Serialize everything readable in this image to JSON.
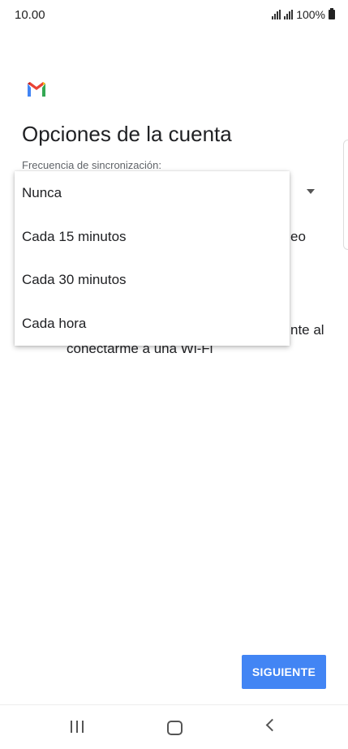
{
  "status_bar": {
    "time": "10.00",
    "battery": "100%"
  },
  "title": "Opciones de la cuenta",
  "sync_label": "Frecuencia de sincronización:",
  "dropdown_options": [
    "Nunca",
    "Cada 15 minutos",
    "Cada 30 minutos",
    "Cada hora"
  ],
  "background_fragments": {
    "line1": "eo",
    "line2": "nte al",
    "line3": "conectarme a una Wi-Fi"
  },
  "next_button_label": "SIGUIENTE",
  "colors": {
    "accent": "#4285f4",
    "checkbox": "#1a73e8"
  }
}
